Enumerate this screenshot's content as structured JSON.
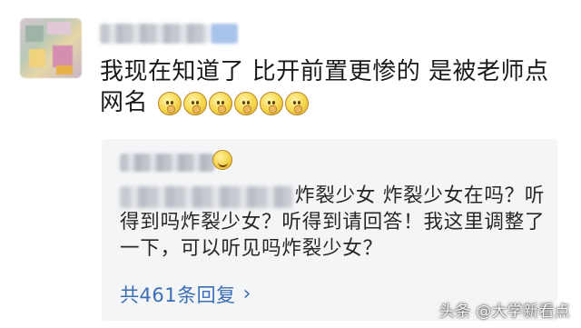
{
  "comment": {
    "text": "我现在知道了 比开前置更惨的 是被老师点网名",
    "emoji_count": 6,
    "emoji_icon": "smirk-hand-on-chin-emoji"
  },
  "reply": {
    "text": "炸裂少女 炸裂少女在吗？听得到吗炸裂少女？听得到请回答！我这里调整了一下，可以听见吗炸裂少女？",
    "emoji_icon": "laughing-emoji"
  },
  "replies_link": {
    "label": "共461条回复",
    "icon": "chevron-right-icon"
  },
  "watermark": {
    "text": "头条 @大学新看点"
  }
}
